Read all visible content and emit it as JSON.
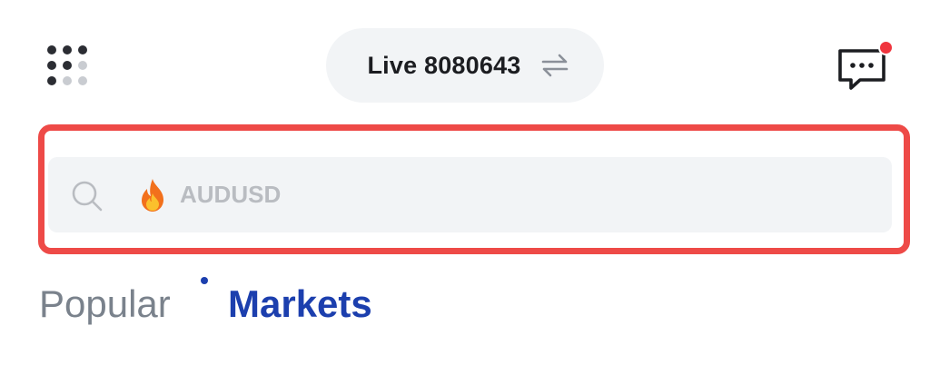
{
  "header": {
    "account": {
      "label": "Live 8080643"
    },
    "menu_icon": "app-grid-icon",
    "swap_icon": "swap-arrows-icon",
    "chat_icon": "chat-bubble-icon",
    "colors": {
      "notification_badge": "#f0353e"
    }
  },
  "search": {
    "placeholder": "AUDUSD",
    "search_icon": "search-icon",
    "trending_icon": "fire-icon",
    "colors": {
      "highlight_outline": "#ee4a47",
      "field_background": "#f2f4f6"
    }
  },
  "tabs": [
    {
      "label": "Popular",
      "active": false
    },
    {
      "label": "Markets",
      "active": true
    }
  ],
  "colors": {
    "accent": "#1c3fae",
    "inactive_tab": "#7a828c"
  }
}
